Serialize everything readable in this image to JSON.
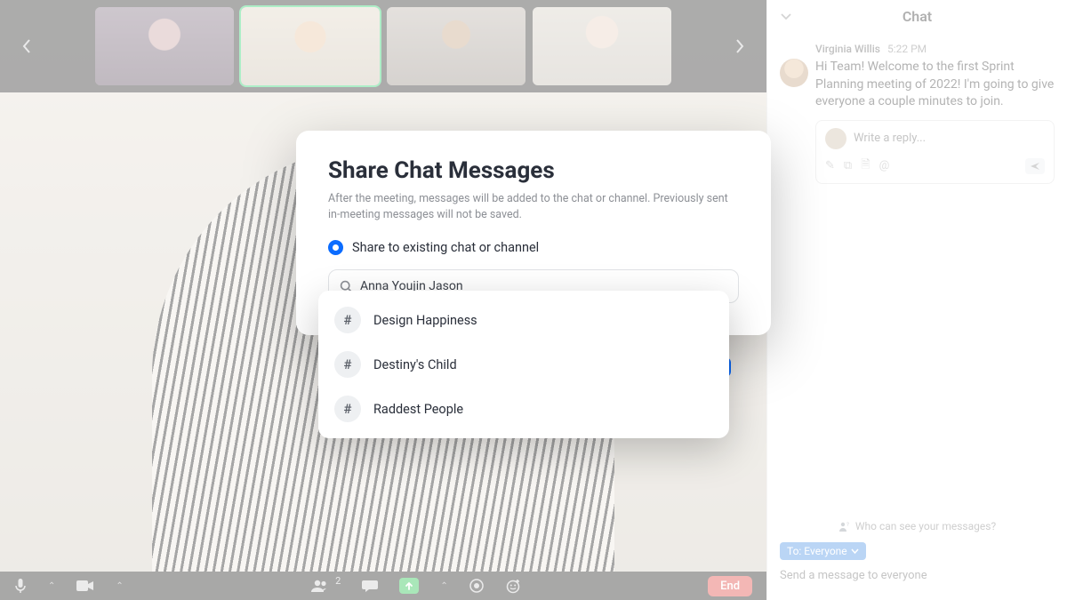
{
  "chat_panel": {
    "title": "Chat",
    "message": {
      "author": "Virginia Willis",
      "time": "5:22 PM",
      "text": "Hi Team! Welcome to the first Sprint Planning meeting of 2022! I'm going to give everyone a couple minutes to join."
    },
    "reply_placeholder": "Write a reply...",
    "who_can_see": "Who can see your messages?",
    "to_label": "To: Everyone",
    "compose_placeholder": "Send a message to everyone"
  },
  "toolbar": {
    "participants_count": "2",
    "end_label": "End"
  },
  "modal": {
    "title": "Share Chat Messages",
    "subtitle": "After the meeting, messages will be added to the chat or channel. Previously sent in-meeting messages will not be saved.",
    "radio_label": "Share to existing chat or channel",
    "search_value": "Anna Youjin Jason"
  },
  "dropdown": {
    "items": [
      {
        "label": "Design Happiness"
      },
      {
        "label": "Destiny's Child"
      },
      {
        "label": "Raddest People"
      }
    ]
  }
}
